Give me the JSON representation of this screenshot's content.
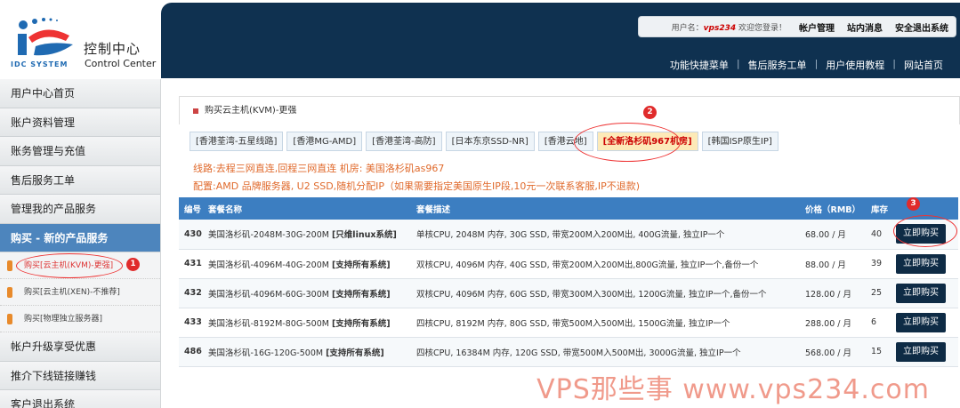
{
  "logo": {
    "cn": "控制中心",
    "en": "Control Center",
    "sys": "IDC SYSTEM"
  },
  "header": {
    "welcome_prefix": "用户名：",
    "username": "vps234",
    "welcome_suffix": "欢迎您登录！",
    "links": [
      "帐户管理",
      "站内消息",
      "安全退出系统"
    ],
    "nav": [
      "功能快捷菜单",
      "售后服务工单",
      "用户使用教程",
      "网站首页"
    ]
  },
  "sidebar": {
    "items_top": [
      "用户中心首页",
      "账户资料管理",
      "账务管理与充值",
      "售后服务工单",
      "管理我的产品服务"
    ],
    "active": "购买 - 新的产品服务",
    "sub": [
      "购买[云主机(KVM)-更强]",
      "购买[云主机(XEN)-不推荐]",
      "购买[物理独立服务器]"
    ],
    "items_bottom": [
      "帐户升级享受优惠",
      "推介下线链接赚钱",
      "客户退出系统"
    ]
  },
  "main": {
    "title": "购买云主机(KVM)-更强",
    "tabs": [
      "[香港荃湾-五星线路]",
      "[香港MG-AMD]",
      "[香港荃湾-高防]",
      "[日本东京SSD-NR]",
      "[香港云地]",
      "[全新洛杉矶967机房]",
      "[韩国ISP原生IP]"
    ],
    "route": "线路:去程三网直连,回程三网直连 机房: 美国洛杉矶as967",
    "config": "配置:AMD 品牌服务器, U2 SSD,随机分配IP（如果需要指定美国原生IP段,10元一次联系客服,IP不退款)",
    "table": {
      "headers": [
        "编号",
        "套餐名称",
        "套餐描述",
        "价格（RMB）",
        "库存",
        ""
      ],
      "buy_label": "立即购买",
      "rows": [
        {
          "id": "430",
          "name": "美国洛杉矶-2048M-30G-200M",
          "tag": "[只维linux系统]",
          "desc": "单核CPU, 2048M 内存, 30G SSD, 带宽200M入200M出, 400G流量, 独立IP一个",
          "price": "68.00 / 月",
          "stock": "40"
        },
        {
          "id": "431",
          "name": "美国洛杉矶-4096M-40G-200M",
          "tag": "[支持所有系统]",
          "desc": "双核CPU, 4096M 内存, 40G SSD, 带宽200M入200M出,800G流量, 独立IP一个,备份一个",
          "price": "88.00 / 月",
          "stock": "39"
        },
        {
          "id": "432",
          "name": "美国洛杉矶-4096M-60G-300M",
          "tag": "[支持所有系统]",
          "desc": "双核CPU, 4096M 内存, 60G SSD, 带宽300M入300M出, 1200G流量, 独立IP一个,备份一个",
          "price": "128.00 / 月",
          "stock": "25"
        },
        {
          "id": "433",
          "name": "美国洛杉矶-8192M-80G-500M",
          "tag": "[支持所有系统]",
          "desc": "四核CPU, 8192M 内存, 80G SSD, 带宽500M入500M出, 1500G流量, 独立IP一个",
          "price": "288.00 / 月",
          "stock": "6"
        },
        {
          "id": "486",
          "name": "美国洛杉矶-16G-120G-500M",
          "tag": "[支持所有系统]",
          "desc": "四核CPU, 16384M 内存, 120G SSD, 带宽500M入500M出, 3000G流量, 独立IP一个",
          "price": "568.00 / 月",
          "stock": "15"
        }
      ]
    }
  },
  "annotations": [
    "1",
    "2",
    "3"
  ],
  "watermark": "VPS那些事 www.vps234.com",
  "colors": {
    "header_bg": "#0f3150",
    "sidebar_active": "#4d85bd",
    "table_header": "#3c7ec1",
    "buy_button": "#0e2b45",
    "route_text": "#e06a2c",
    "annotation_red": "#e02b2b"
  }
}
